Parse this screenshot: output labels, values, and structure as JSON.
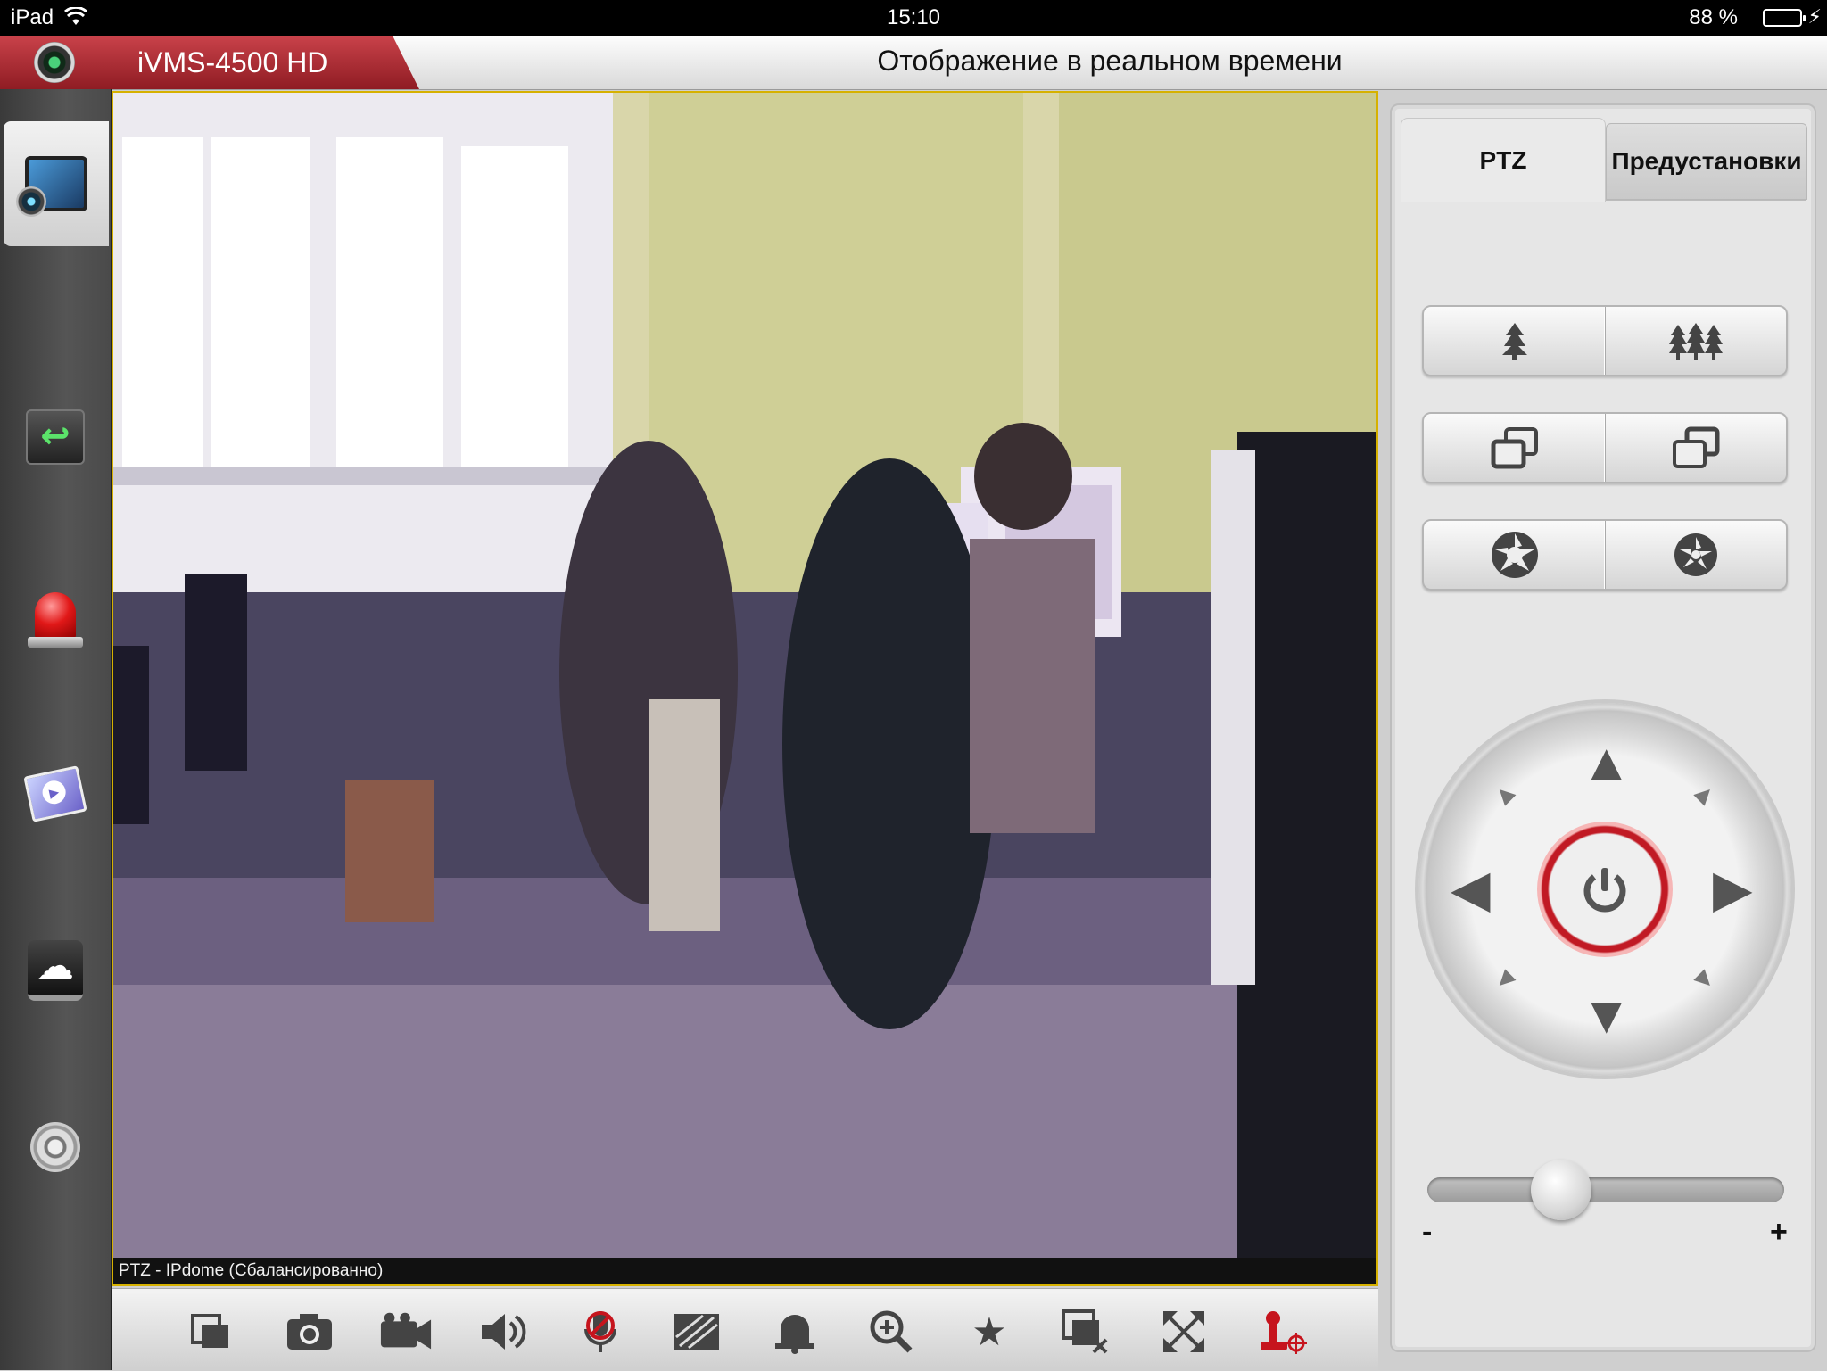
{
  "status_bar": {
    "device": "iPad",
    "time": "15:10",
    "battery": "88 %",
    "battery_level": 0.88
  },
  "title_bar": {
    "app_name": "iVMS-4500 HD",
    "page_title": "Отображение в реальном времени"
  },
  "sidebar": {
    "items": [
      {
        "name": "live-view",
        "icon": "camera-icon",
        "active": true
      },
      {
        "name": "playback",
        "icon": "playback-icon"
      },
      {
        "name": "alarm",
        "icon": "alarm-siren-icon"
      },
      {
        "name": "gallery",
        "icon": "gallery-icon"
      },
      {
        "name": "cloud",
        "icon": "cloud-icon"
      },
      {
        "name": "settings",
        "icon": "gear-icon"
      }
    ]
  },
  "video": {
    "caption": "PTZ - IPdome (Сбалансированно)",
    "border_color": "#d6b100"
  },
  "toolbar": {
    "items": [
      "layout-icon",
      "snapshot-icon",
      "record-icon",
      "audio-icon",
      "talk-icon",
      "image-quality-icon",
      "alarm-output-icon",
      "digital-zoom-icon",
      "favorite-icon",
      "close-all-icon",
      "fullscreen-icon",
      "ptz-control-icon"
    ]
  },
  "ptz_panel": {
    "tabs": [
      {
        "label": "PTZ",
        "active": true
      },
      {
        "label": "Предустановки",
        "active": false
      }
    ],
    "speed_slider": {
      "min_label": "-",
      "max_label": "+",
      "value": 0.35
    },
    "accent_color": "#c11a24"
  }
}
